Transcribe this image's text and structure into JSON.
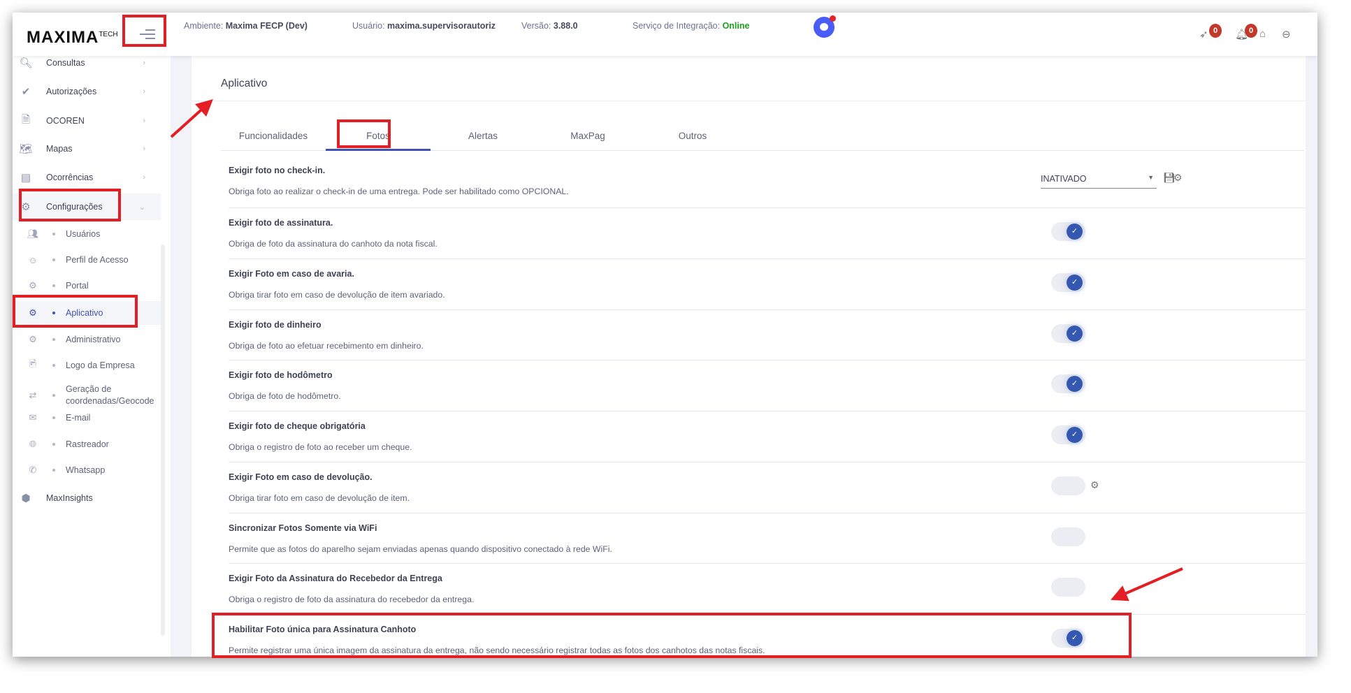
{
  "header": {
    "logo": "MAXIMA",
    "logo_sup": "TECH",
    "ambiente_label": "Ambiente:",
    "ambiente": "Maxima FECP (Dev)",
    "usuario_label": "Usuário:",
    "usuario": "maxima.supervisorautoriz",
    "versao_label": "Versão:",
    "versao": "3.88.0",
    "servico_label": "Serviço de Integração:",
    "servico": "Online",
    "badge_rocket": "0",
    "badge_bell": "0"
  },
  "sidebar": {
    "items": [
      {
        "label": "Consultas"
      },
      {
        "label": "Autorizações"
      },
      {
        "label": "OCOREN"
      },
      {
        "label": "Mapas"
      },
      {
        "label": "Ocorrências"
      },
      {
        "label": "Configurações"
      }
    ],
    "sub": [
      {
        "label": "Usuários"
      },
      {
        "label": "Perfil de Acesso"
      },
      {
        "label": "Portal"
      },
      {
        "label": "Aplicativo"
      },
      {
        "label": "Administrativo"
      },
      {
        "label": "Logo da Empresa"
      },
      {
        "label": "Geração de coordenadas/Geocode"
      },
      {
        "label": "E-mail"
      },
      {
        "label": "Rastreador"
      },
      {
        "label": "Whatsapp"
      }
    ],
    "maxinsights": "MaxInsights"
  },
  "main": {
    "title": "Aplicativo",
    "tabs": [
      {
        "label": "Funcionalidades"
      },
      {
        "label": "Fotos"
      },
      {
        "label": "Alertas"
      },
      {
        "label": "MaxPag"
      },
      {
        "label": "Outros"
      }
    ],
    "rows": [
      {
        "title": "Exigir foto no check-in.",
        "desc": "Obriga foto ao realizar o check-in de uma entrega. Pode ser habilitado como OPCIONAL.",
        "select": "INATIVADO"
      },
      {
        "title": "Exigir foto de assinatura.",
        "desc": "Obriga de foto da assinatura do canhoto da nota fiscal.",
        "on": true
      },
      {
        "title": "Exigir Foto em caso de avaria.",
        "desc": "Obriga tirar foto em caso de devolução de item avariado.",
        "on": true
      },
      {
        "title": "Exigir foto de dinheiro",
        "desc": "Obriga de foto ao efetuar recebimento em dinheiro.",
        "on": true
      },
      {
        "title": "Exigir foto de hodômetro",
        "desc": "Obriga de foto de hodômetro.",
        "on": true
      },
      {
        "title": "Exigir foto de cheque obrigatória",
        "desc": "Obriga o registro de foto ao receber um cheque.",
        "on": true
      },
      {
        "title": "Exigir Foto em caso de devolução.",
        "desc": "Obriga tirar foto em caso de devolução de item.",
        "on": false
      },
      {
        "title": "Sincronizar Fotos Somente via WiFi",
        "desc": "Permite que as fotos do aparelho sejam enviadas apenas quando dispositivo conectado à rede WiFi.",
        "on": false
      },
      {
        "title": "Exigir Foto da Assinatura do Recebedor da Entrega",
        "desc": "Obriga o registro de foto da assinatura do recebedor da entrega.",
        "on": false
      },
      {
        "title": "Habilitar Foto única para Assinatura Canhoto",
        "desc": "Permite registrar uma única imagem da assinatura da entrega, não sendo necessário registrar todas as fotos dos canhotos das notas fiscais.",
        "on": true
      }
    ]
  },
  "colors": {
    "accent": "#3f51b5",
    "toggle_on": "#3457b0",
    "online": "#1e9e1e",
    "annotation": "#e31e24"
  }
}
